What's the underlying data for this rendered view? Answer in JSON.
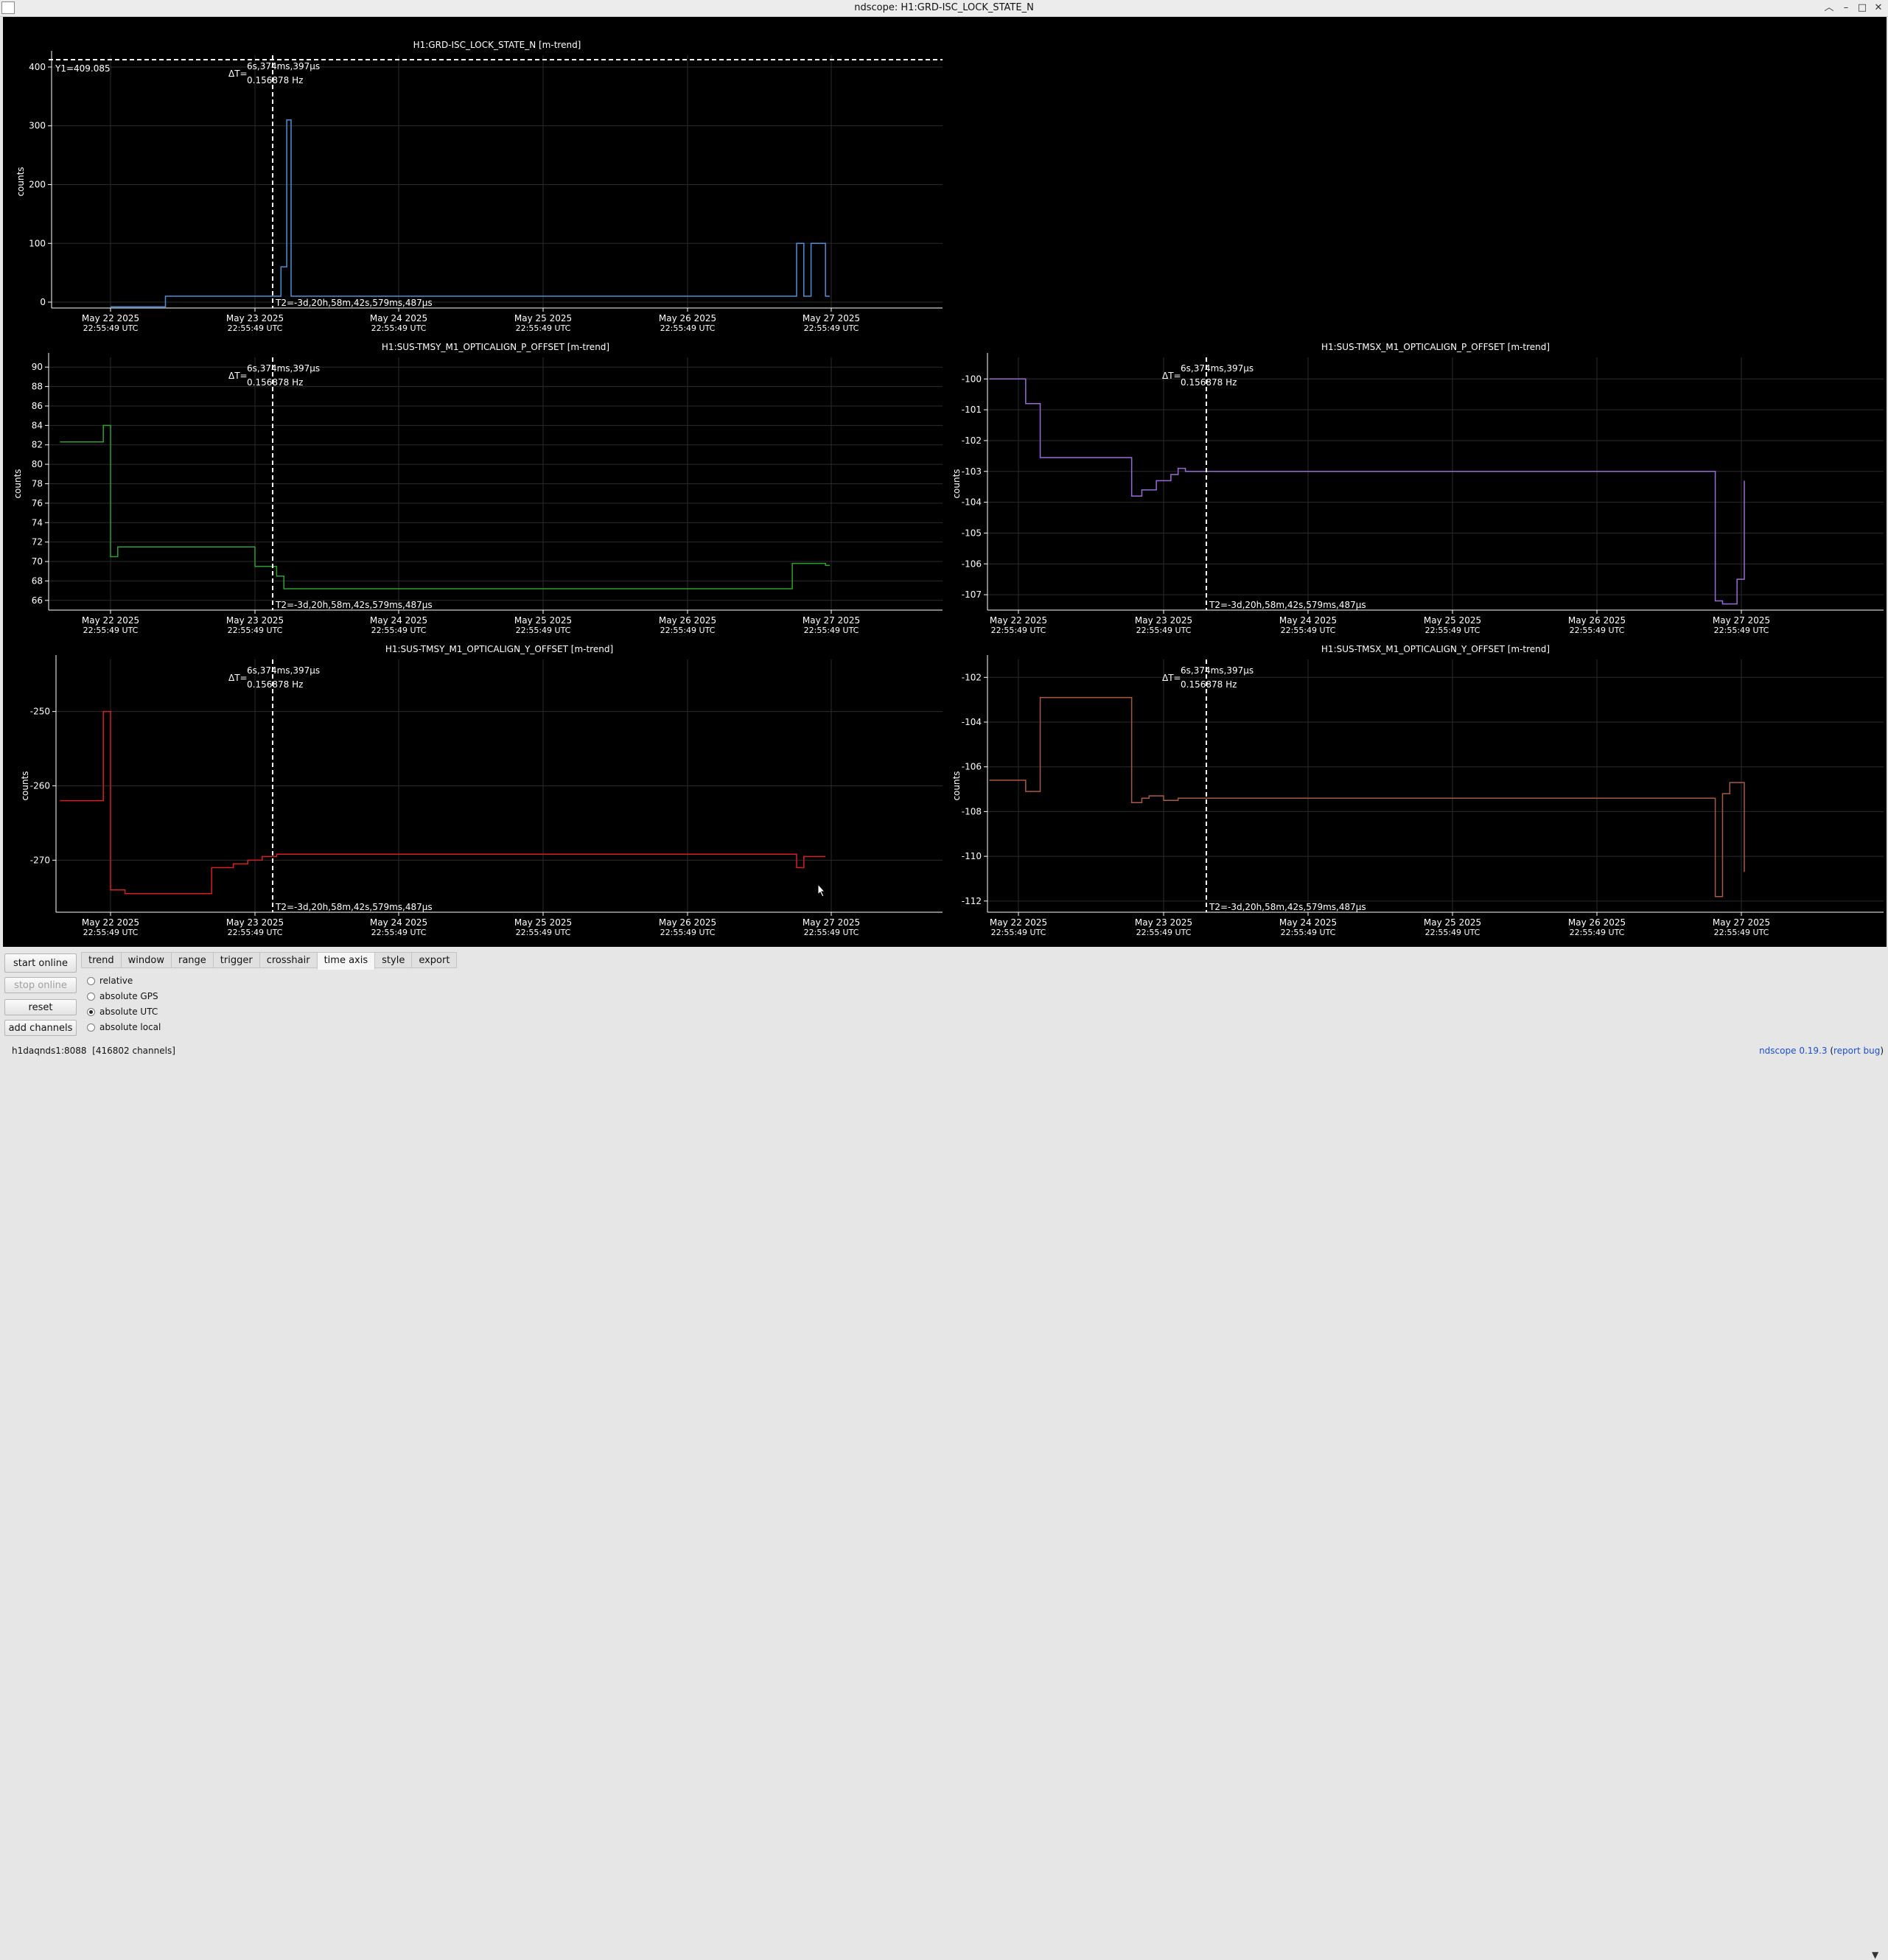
{
  "window": {
    "title": "ndscope: H1:GRD-ISC_LOCK_STATE_N",
    "minimize": "–",
    "maximize": "□",
    "close": "✕",
    "chevron": "︿"
  },
  "colors": {
    "background": "#000000",
    "axis": "#ffffff",
    "grid": "#2b2b2b",
    "cursor": "#ffffff"
  },
  "time_axis": {
    "ticks": [
      "May 22 2025",
      "May 23 2025",
      "May 24 2025",
      "May 25 2025",
      "May 26 2025",
      "May 27 2025"
    ],
    "tick_time": "22:55:49 UTC"
  },
  "cursor": {
    "delta_label": "ΔT=",
    "delta_value": "6s,374ms,397µs",
    "delta_freq": "0.156878 Hz",
    "t2_label": "T2=-3d,20h,58m,42s,579ms,487µs"
  },
  "plots": [
    {
      "title": "H1:GRD-ISC_LOCK_STATE_N [m-trend]",
      "ylabel": "counts",
      "color": "#4a90d9",
      "yticks": [
        "400",
        "300",
        "200",
        "100",
        "0"
      ],
      "ylim": [
        -10,
        420
      ],
      "y1_label": "Y1=409.085"
    },
    {
      "title": "H1:SUS-TMSY_M1_OPTICALIGN_P_OFFSET [m-trend]",
      "ylabel": "counts",
      "color": "#2ea12e",
      "yticks": [
        "90",
        "88",
        "86",
        "84",
        "82",
        "80",
        "78",
        "76",
        "74",
        "72",
        "70",
        "68",
        "66"
      ],
      "ylim": [
        65,
        91
      ]
    },
    {
      "title": "H1:SUS-TMSX_M1_OPTICALIGN_P_OFFSET [m-trend]",
      "ylabel": "counts",
      "color": "#9a6bd8",
      "yticks": [
        "-100",
        "-101",
        "-102",
        "-103",
        "-104",
        "-105",
        "-106",
        "-107"
      ],
      "ylim": [
        -107.5,
        -99.3
      ]
    },
    {
      "title": "H1:SUS-TMSY_M1_OPTICALIGN_Y_OFFSET [m-trend]",
      "ylabel": "counts",
      "color": "#d42020",
      "yticks": [
        "-250",
        "-260",
        "-270"
      ],
      "ylim": [
        -277,
        -243
      ]
    },
    {
      "title": "H1:SUS-TMSX_M1_OPTICALIGN_Y_OFFSET [m-trend]",
      "ylabel": "counts",
      "color": "#a85a40",
      "yticks": [
        "-102",
        "-104",
        "-106",
        "-108",
        "-110",
        "-112"
      ],
      "ylim": [
        -112.5,
        -101.2
      ]
    }
  ],
  "chart_data": [
    {
      "type": "line",
      "title": "H1:GRD-ISC_LOCK_STATE_N [m-trend]",
      "ylabel": "counts",
      "ylim": [
        -10,
        420
      ],
      "x": [
        0,
        0.35,
        0.38,
        1.15,
        1.18,
        1.22,
        1.25,
        4.7,
        4.75,
        4.8,
        4.85,
        4.95,
        4.98
      ],
      "series": [
        {
          "values": [
            -8,
            -8,
            10,
            10,
            60,
            310,
            10,
            10,
            100,
            10,
            100,
            10,
            10
          ]
        }
      ]
    },
    {
      "type": "line",
      "title": "H1:SUS-TMSY_M1_OPTICALIGN_P_OFFSET [m-trend]",
      "ylabel": "counts",
      "ylim": [
        65,
        91
      ],
      "x": [
        -0.35,
        -0.1,
        -0.05,
        0.0,
        0.05,
        0.1,
        0.4,
        0.8,
        1.0,
        1.02,
        1.15,
        1.2,
        4.7,
        4.72,
        4.95,
        4.98
      ],
      "series": [
        {
          "values": [
            82.3,
            82.3,
            84,
            70.5,
            71.5,
            71.5,
            71.5,
            71.5,
            69.5,
            69.5,
            68.5,
            67.2,
            67.2,
            69.8,
            69.6,
            69.6
          ]
        }
      ]
    },
    {
      "type": "line",
      "title": "H1:SUS-TMSX_M1_OPTICALIGN_P_OFFSET [m-trend]",
      "ylabel": "counts",
      "ylim": [
        -107.5,
        -99.3
      ],
      "x": [
        -0.2,
        0.0,
        0.05,
        0.12,
        0.15,
        0.75,
        0.78,
        0.85,
        0.95,
        1.05,
        1.1,
        1.15,
        4.75,
        4.8,
        4.85,
        4.95,
        5.0
      ],
      "series": [
        {
          "values": [
            -100,
            -100,
            -100.8,
            -100.8,
            -102.55,
            -102.55,
            -103.8,
            -103.6,
            -103.3,
            -103.1,
            -102.9,
            -103.0,
            -103.0,
            -107.2,
            -107.3,
            -106.5,
            -103.3
          ]
        }
      ]
    },
    {
      "type": "line",
      "title": "H1:SUS-TMSY_M1_OPTICALIGN_Y_OFFSET [m-trend]",
      "ylabel": "counts",
      "ylim": [
        -277,
        -243
      ],
      "x": [
        -0.35,
        -0.1,
        -0.05,
        0.0,
        0.1,
        0.6,
        0.7,
        0.85,
        0.95,
        1.05,
        1.15,
        4.7,
        4.75,
        4.8,
        4.95
      ],
      "series": [
        {
          "values": [
            -262,
            -262,
            -250,
            -274,
            -274.5,
            -274.5,
            -271,
            -270.5,
            -270,
            -269.5,
            -269.2,
            -269.2,
            -271,
            -269.5,
            -269.5
          ]
        }
      ]
    },
    {
      "type": "line",
      "title": "H1:SUS-TMSX_M1_OPTICALIGN_Y_OFFSET [m-trend]",
      "ylabel": "counts",
      "ylim": [
        -112.5,
        -101.2
      ],
      "x": [
        -0.2,
        0.0,
        0.05,
        0.12,
        0.15,
        0.75,
        0.78,
        0.85,
        0.9,
        1.0,
        1.1,
        4.75,
        4.8,
        4.85,
        4.9,
        4.98,
        5.0
      ],
      "series": [
        {
          "values": [
            -106.6,
            -106.6,
            -107.1,
            -107.1,
            -102.9,
            -102.9,
            -107.6,
            -107.4,
            -107.3,
            -107.5,
            -107.4,
            -107.4,
            -111.8,
            -107.2,
            -106.7,
            -106.7,
            -110.7
          ]
        }
      ]
    }
  ],
  "controls": {
    "buttons": {
      "start_online": "start online",
      "stop_online": "stop online",
      "reset": "reset",
      "add_channels": "add channels"
    },
    "tabs": [
      "trend",
      "window",
      "range",
      "trigger",
      "crosshair",
      "time axis",
      "style",
      "export"
    ],
    "active_tab": "time axis",
    "radios": [
      {
        "label": "relative",
        "checked": false
      },
      {
        "label": "absolute GPS",
        "checked": false
      },
      {
        "label": "absolute UTC",
        "checked": true
      },
      {
        "label": "absolute local",
        "checked": false
      }
    ]
  },
  "status": {
    "server": "h1daqnds1:8088",
    "channels": "[416802 channels]"
  },
  "footer": {
    "app_link": "ndscope",
    "version_link": "0.19.3",
    "report": "report bug"
  }
}
